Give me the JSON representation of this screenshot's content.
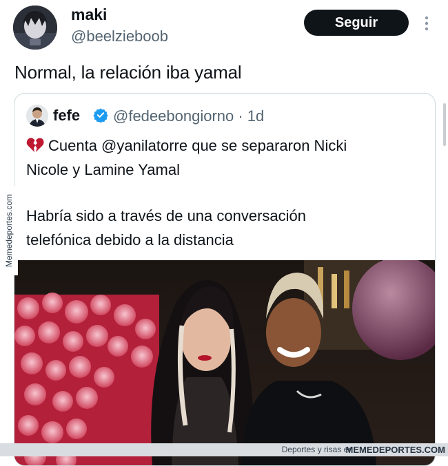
{
  "tweet": {
    "author": {
      "name": "maki",
      "handle": "@beelzieboob",
      "avatar_icon": "anime-avatar"
    },
    "follow_label": "Seguir",
    "more_icon": "more-vertical-icon",
    "text": "Normal, la relación iba yamal"
  },
  "quoted_tweet": {
    "author": {
      "name": "fefe",
      "handle": "@fedeebongiorno · 1d",
      "verified": true
    },
    "lines": [
      "Cuenta @yanilatorre que se separaron Nicki",
      "Nicole y Lamine Yamal",
      "Habría sido a través de una conversación",
      "telefónica debido a la distancia"
    ],
    "emoji_icon": "broken-heart"
  },
  "watermark": {
    "side_text": "Memedeportes.com",
    "footer_tagline": "Deportes y risas en",
    "footer_brand": "MEMEDEPORTES.COM"
  },
  "colors": {
    "text": "#0f1419",
    "muted": "#536471",
    "button": "#0f1419",
    "verified": "#1d9bf0",
    "heart": "#be1931"
  }
}
